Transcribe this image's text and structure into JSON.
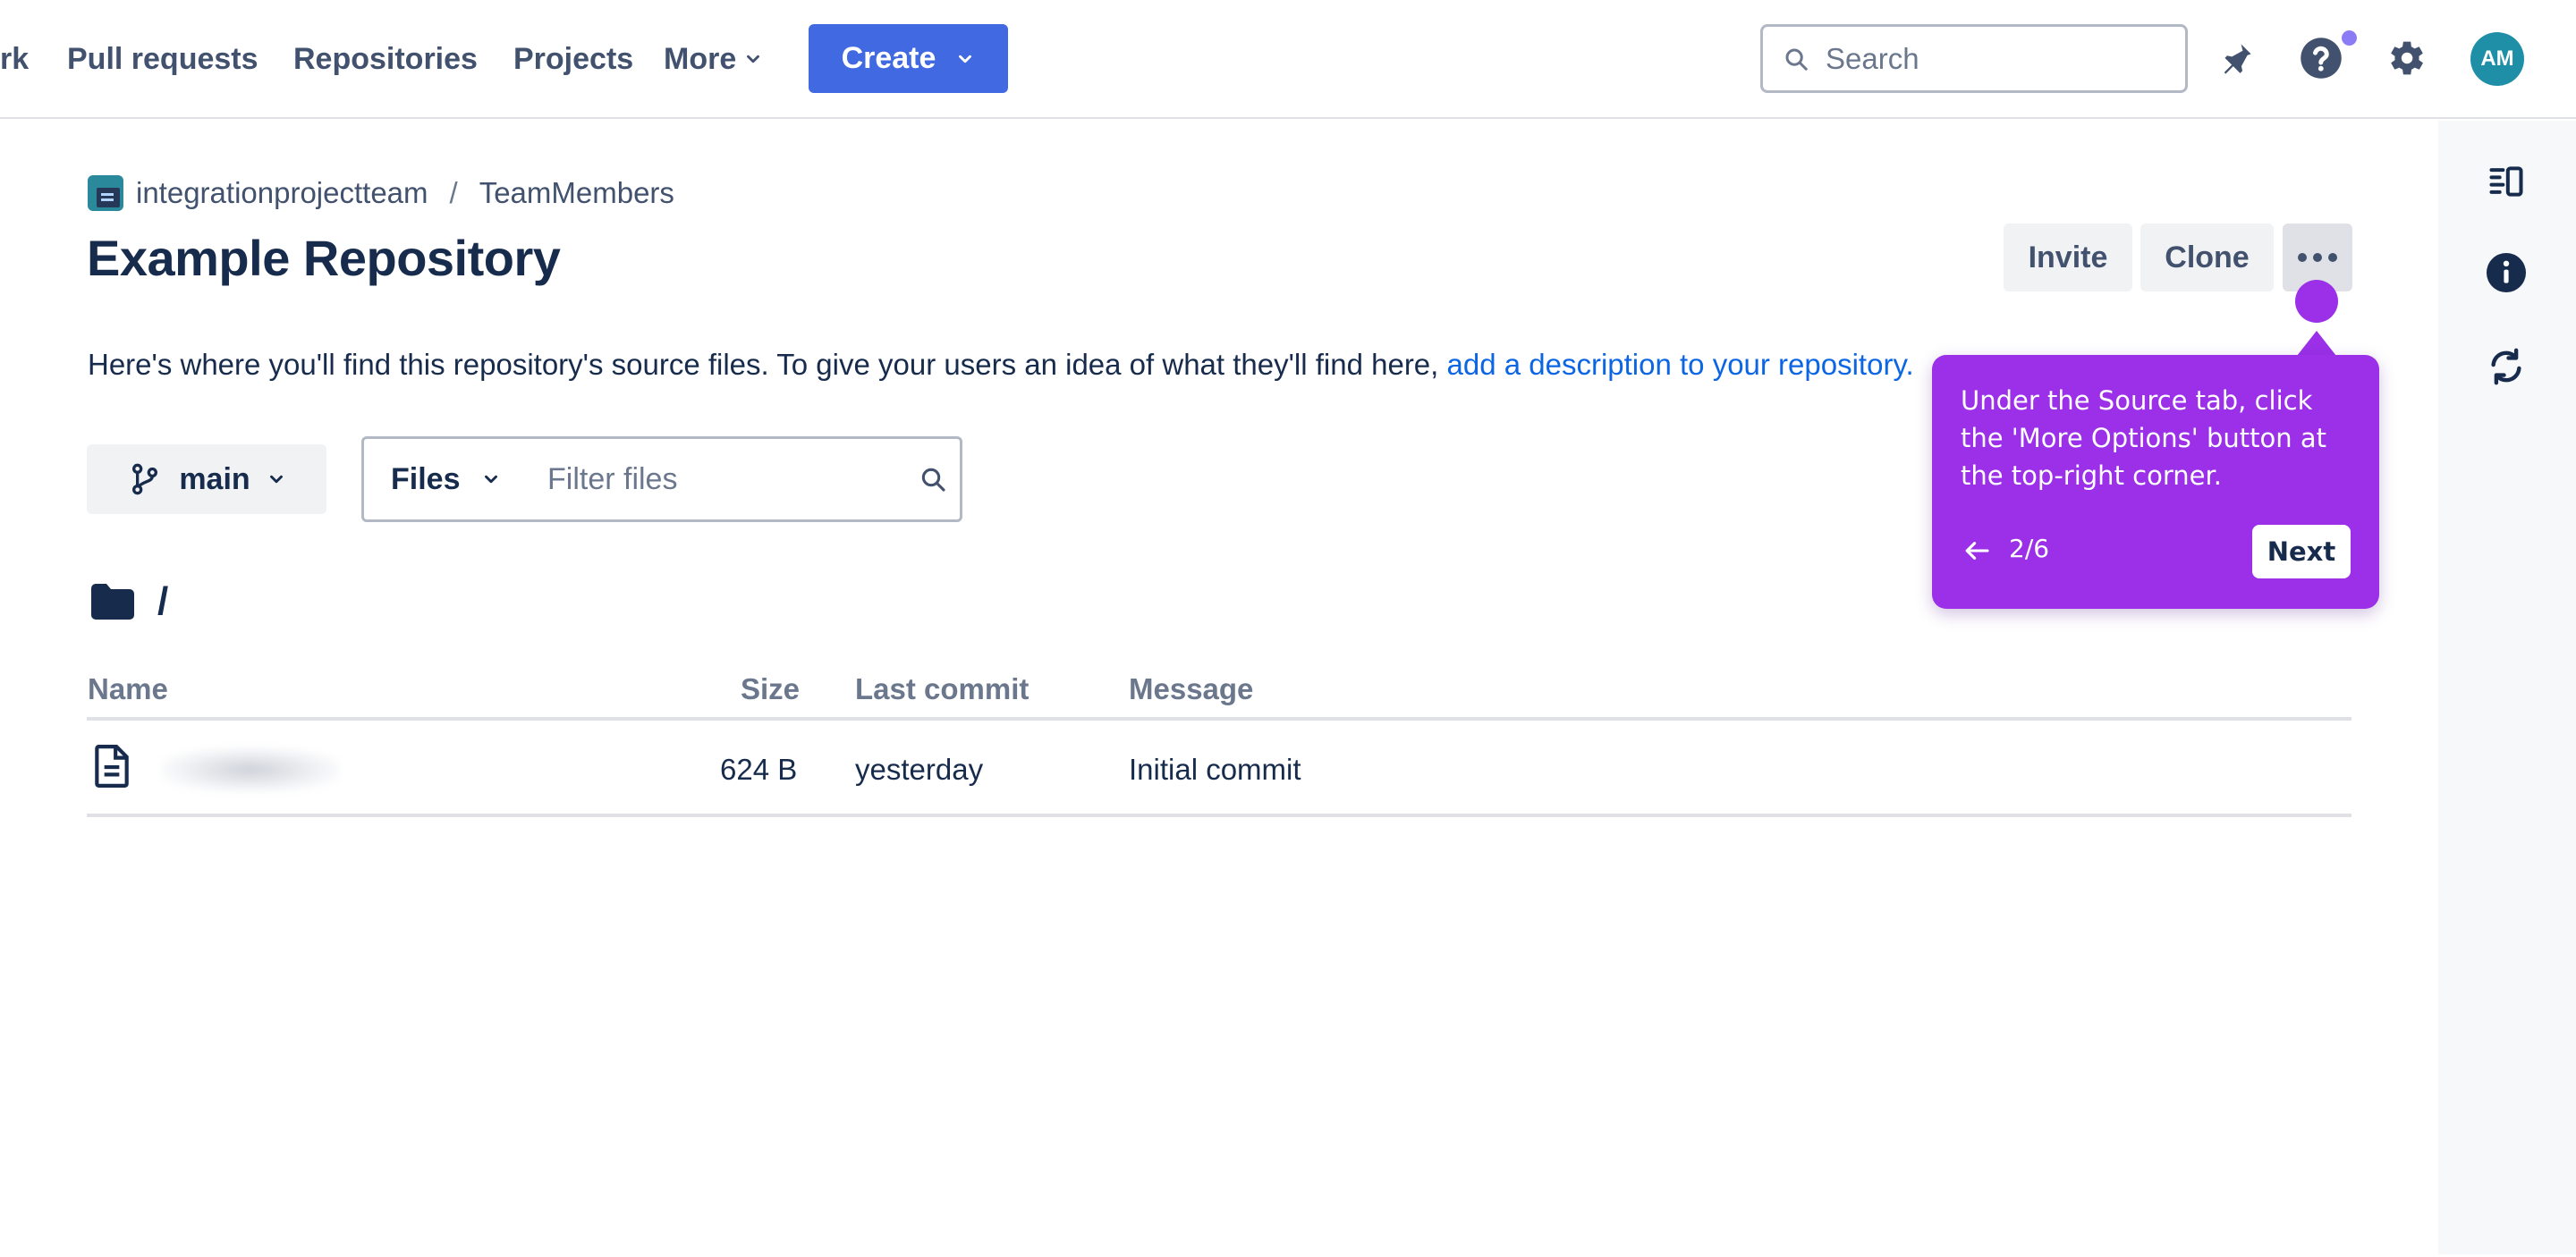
{
  "nav": {
    "items": [
      {
        "label": "rk"
      },
      {
        "label": "Pull requests"
      },
      {
        "label": "Repositories"
      },
      {
        "label": "Projects"
      }
    ],
    "more_label": "More",
    "create_label": "Create",
    "search_placeholder": "Search",
    "avatar_initials": "AM"
  },
  "breadcrumb": {
    "workspace": "integrationprojectteam",
    "separator": "/",
    "project": "TeamMembers"
  },
  "page_title": "Example Repository",
  "actions": {
    "invite_label": "Invite",
    "clone_label": "Clone"
  },
  "description": {
    "text": "Here's where you'll find this repository's source files. To give your users an idea of what they'll find here, ",
    "link": "add a description to your repository."
  },
  "branch": {
    "label": "main"
  },
  "filter": {
    "type_label": "Files",
    "placeholder": "Filter files"
  },
  "path": "/",
  "table": {
    "headers": {
      "name": "Name",
      "size": "Size",
      "last_commit": "Last commit",
      "message": "Message"
    },
    "rows": [
      {
        "name": "",
        "size": "624 B",
        "last_commit": "yesterday",
        "message": "Initial commit"
      }
    ]
  },
  "tooltip": {
    "text": "Under the Source tab, click the 'More Options' button at the top-right corner.",
    "step": "2/6",
    "next_label": "Next"
  },
  "colors": {
    "primary": "#4169e1",
    "tooltip": "#9b30e8",
    "link": "#0c66e4",
    "text": "#172b4d"
  }
}
